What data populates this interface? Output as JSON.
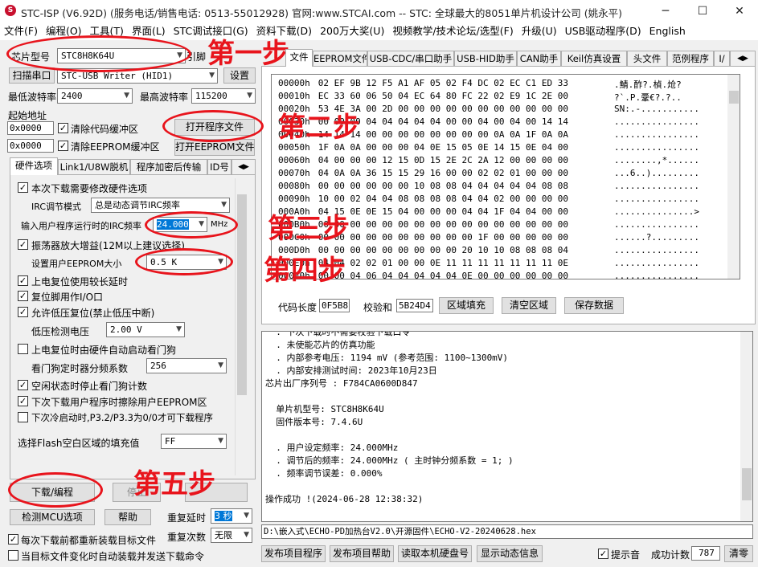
{
  "window": {
    "title": "STC-ISP (V6.92D) (服务电话/销售电话: 0513-55012928) 官网:www.STCAI.com  -- STC: 全球最大的8051单片机设计公司 (姚永平)",
    "minimize": "─",
    "maximize": "☐",
    "close": "✕"
  },
  "menu": [
    "文件(F)",
    "编程(O)",
    "工具(T)",
    "界面(L)",
    "STC调试接口(G)",
    "资料下载(D)",
    "200万大奖(U)",
    "视频教学/技术论坛/选型(F)",
    "升级(U)",
    "USB驱动程序(D)",
    "English"
  ],
  "left": {
    "chip_label": "芯片型号",
    "chip_value": "STC8H8K64U",
    "pin_label": "引脚",
    "scan_button": "扫描串口",
    "port_value": "STC-USB Writer (HID1)",
    "settings_button": "设置",
    "min_baud_label": "最低波特率",
    "min_baud_value": "2400",
    "max_baud_label": "最高波特率",
    "max_baud_value": "115200",
    "start_addr_label": "起始地址",
    "addr1": "0x0000",
    "clear_code": "清除代码缓冲区",
    "open_program": "打开程序文件",
    "addr2": "0x0000",
    "clear_eeprom": "清除EEPROM缓冲区",
    "open_eeprom": "打开EEPROM文件",
    "tabs": [
      "硬件选项",
      "Link1/U8W脱机",
      "程序加密后传输",
      "ID号"
    ],
    "options": {
      "opt1": "本次下载需要修改硬件选项",
      "irc_mode_label": "IRC调节模式",
      "irc_mode_value": "总是动态调节IRC频率",
      "freq_label": "输入用户程序运行时的IRC频率",
      "freq_value": "24.000",
      "freq_unit": "MHz",
      "opt_osc": "振荡器放大增益(12M以上建议选择)",
      "eeprom_size_label": "设置用户EEPROM大小",
      "eeprom_size_value": "0.5 K",
      "opt_por": "上电复位使用较长延时",
      "opt_reset_io": "复位脚用作I/O口",
      "opt_lvr": "允许低压复位(禁止低压中断)",
      "lv_label": "低压检测电压",
      "lv_value": "2.00 V",
      "opt_wdt": "上电复位时由硬件自动启动看门狗",
      "wdt_label": "看门狗定时器分频系数",
      "wdt_value": "256",
      "opt_idle": "空闲状态时停止看门狗计数",
      "opt_erase": "下次下载用户程序时擦除用户EEPROM区",
      "opt_p32": "下次冷启动时,P3.2/P3.3为0/0才可下载程序",
      "fill_label": "选择Flash空白区域的填充值",
      "fill_value": "FF"
    },
    "download_button": "下载/编程",
    "stop_button": "停止",
    "detect_button": "检测MCU选项",
    "help_button": "帮助",
    "repeat_delay_label": "重复延时",
    "repeat_delay_value": "3 秒",
    "repeat_count_label": "重复次数",
    "repeat_count_value": "无限",
    "reload_label": "每次下载前都重新装载目标文件",
    "auto_label": "当目标文件变化时自动装载并发送下载命令"
  },
  "right": {
    "tabs": [
      "文件",
      "EEPROM文件",
      "USB-CDC/串口助手",
      "USB-HID助手",
      "CAN助手",
      "Keil仿真设置",
      "头文件",
      "范例程序",
      "I/"
    ],
    "hex_rows": [
      {
        "addr": "00000h",
        "bytes": "02 EF 9B 12 F5 A1 AF 05 02 F4 DC 02 EC C1 ED 33",
        "ascii": ".鯖.酢?.楨.炝?"
      },
      {
        "addr": "00010h",
        "bytes": "EC 33 60 06 50 04 EC 64 80 FC 22 02 E9 1C 2E 00",
        "ascii": "?`.P.鞷€?.?.."
      },
      {
        "addr": "00020h",
        "bytes": "53 4E 3A 00 2D 00 00 00 00 00 00 00 00 00 00 00",
        "ascii": "SN:.-..........."
      },
      {
        "addr": "00030h",
        "bytes": "00 00 00 04 04 04 04 04 00 00 04 00 04 00 14 14",
        "ascii": "................"
      },
      {
        "addr": "00040h",
        "bytes": "14 14 14 00 00 00 00 00 00 00 00 0A 0A 1F 0A 0A",
        "ascii": "................"
      },
      {
        "addr": "00050h",
        "bytes": "1F 0A 0A 00 00 00 04 0E 15 05 0E 14 15 0E 04 00",
        "ascii": "................"
      },
      {
        "addr": "00060h",
        "bytes": "04 00 00 00 12 15 0D 15 2E 2C 2A 12 00 00 00 00",
        "ascii": "........,*......"
      },
      {
        "addr": "00070h",
        "bytes": "04 0A 0A 36 15 15 29 16 00 00 02 02 01 00 00 00",
        "ascii": "...6..)........."
      },
      {
        "addr": "00080h",
        "bytes": "00 00 00 00 00 00 10 08 08 04 04 04 04 04 08 08",
        "ascii": "................"
      },
      {
        "addr": "00090h",
        "bytes": "10 00 02 04 04 08 08 08 08 04 04 02 00 00 00 00",
        "ascii": "................"
      },
      {
        "addr": "000A0h",
        "bytes": "04 15 0E 0E 15 04 00 00 00 04 04 1F 04 04 00 00",
        "ascii": "...............>"
      },
      {
        "addr": "000B0h",
        "bytes": "00 00 00 00 00 00 00 00 00 00 00 00 00 00 00 00",
        "ascii": "................"
      },
      {
        "addr": "000C0h",
        "bytes": "00 00 00 00 00 00 00 00 00 00 1F 00 00 00 00 00",
        "ascii": "......?........."
      },
      {
        "addr": "000D0h",
        "bytes": "00 00 00 00 00 00 00 00 00 20 10 10 08 08 08 04",
        "ascii": "................"
      },
      {
        "addr": "000E0h",
        "bytes": "04 04 02 02 01 00 00 0E 11 11 11 11 11 11 11 0E",
        "ascii": "................"
      },
      {
        "addr": "000F0h",
        "bytes": "00 00 04 06 04 04 04 04 04 0E 00 00 00 00 00 00",
        "ascii": "................"
      }
    ],
    "code_len_label": "代码长度",
    "code_len_value": "0F5B8",
    "checksum_label": "校验和",
    "checksum_value": "5B24D4",
    "fill_button": "区域填充",
    "clear_button": "清空区域",
    "save_button": "保存数据",
    "log_lines": [
      "  . 下次下载时不需要校验下载口令",
      "  . 未使能芯片的仿真功能",
      "  . 内部参考电压: 1194 mV (参考范围: 1100~1300mV)",
      "  . 内部安排测试时间: 2023年10月23日",
      "芯片出厂序列号 : F784CA0600D847",
      "",
      "  单片机型号: STC8H8K64U",
      "  固件版本号: 7.4.6U",
      "",
      "  . 用户设定频率: 24.000MHz",
      "  . 调节后的频率: 24.000MHz ( 主时钟分频系数 = 1; )",
      "  . 频率调节误差: 0.000%",
      "",
      "操作成功 !(2024-06-28 12:38:32)"
    ],
    "path": "D:\\嵌入式\\ECHO-PD加热台V2.0\\开源固件\\ECHO-V2-20240628.hex",
    "publish_project": "发布项目程序",
    "publish_help": "发布项目帮助",
    "read_serial": "读取本机硬盘号",
    "show_dynamic": "显示动态信息",
    "beep_label": "提示音",
    "success_label": "成功计数",
    "success_value": "787",
    "clear_count": "清零"
  },
  "annotations": [
    "第一步",
    "第二步",
    "第三步",
    "第四步",
    "第五步"
  ],
  "colors": {
    "annotation": "#e8141c",
    "highlight": "#0078d7"
  }
}
